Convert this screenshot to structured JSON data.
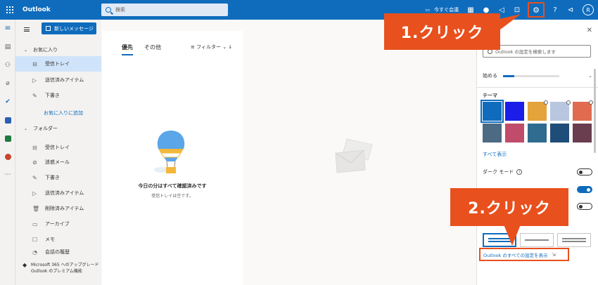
{
  "app": {
    "title": "Outlook"
  },
  "search": {
    "placeholder": "検索"
  },
  "topbar": {
    "meet_now": "今すぐ会議",
    "avatar_initial": "R"
  },
  "folder_pane": {
    "new_message": "新しいメッセージ",
    "favorites_header": "お気に入り",
    "favorites": [
      {
        "label": "受信トレイ",
        "icon": "inbox-icon",
        "active": true
      },
      {
        "label": "送信済みアイテム",
        "icon": "send-icon",
        "active": false
      },
      {
        "label": "下書き",
        "icon": "draft-icon",
        "active": false
      }
    ],
    "add_favorite": "お気に入りに追加",
    "folders_header": "フォルダー",
    "folders": [
      {
        "label": "受信トレイ",
        "icon": "inbox-icon"
      },
      {
        "label": "迷惑メール",
        "icon": "junk-icon"
      },
      {
        "label": "下書き",
        "icon": "draft-icon"
      },
      {
        "label": "送信済みアイテム",
        "icon": "send-icon"
      },
      {
        "label": "削除済みアイテム",
        "icon": "trash-icon"
      },
      {
        "label": "アーカイブ",
        "icon": "archive-icon"
      },
      {
        "label": "メモ",
        "icon": "note-icon"
      },
      {
        "label": "会話の履歴",
        "icon": "history-icon"
      }
    ],
    "premium_text": "Microsoft 365 へのアップグレード Outlook のプレミアム機能"
  },
  "message_list": {
    "tabs": [
      "優先",
      "その他"
    ],
    "filter_label": "フィルター",
    "empty_title": "今日の分はすべて確認済みです",
    "empty_subtitle": "受信トレイは空です。"
  },
  "settings_panel": {
    "search_placeholder": "Outlook の設定を検索します",
    "getting_started": "始める",
    "getting_started_progress": 0.2,
    "theme_label": "テーマ",
    "themes": [
      {
        "name": "blue",
        "color": "#0f6cbd",
        "selected": true
      },
      {
        "name": "dark-blue",
        "color": "#1a1ee8",
        "selected": false
      },
      {
        "name": "rainbow",
        "color": "#e4a33b",
        "selected": false
      },
      {
        "name": "abstract",
        "color": "#b9c6e0",
        "selected": false
      },
      {
        "name": "colorful",
        "color": "#e06b4e",
        "selected": false
      },
      {
        "name": "landscape",
        "color": "#4d6a84",
        "selected": false
      },
      {
        "name": "palm",
        "color": "#c14b6a",
        "selected": false
      },
      {
        "name": "waves",
        "color": "#2f6c8f",
        "selected": false
      },
      {
        "name": "circuit",
        "color": "#1f4d79",
        "selected": false
      },
      {
        "name": "lights",
        "color": "#6a3d4f",
        "selected": false
      }
    ],
    "view_all": "すべて表示",
    "dark_mode_label": "ダーク モード",
    "toggles": [
      {
        "label": "ダーク モード",
        "on": false
      },
      {
        "label": "",
        "on": true
      },
      {
        "label": "",
        "on": false
      }
    ],
    "all_settings_link": "Outlook のすべての設定を表示"
  },
  "callouts": {
    "first": "1.クリック",
    "second": "2.クリック",
    "color": "#e8501e"
  }
}
